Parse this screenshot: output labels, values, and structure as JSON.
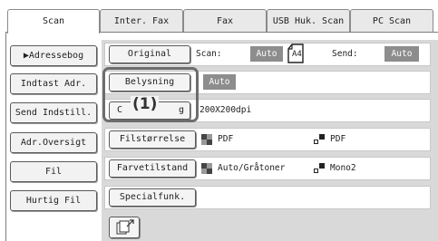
{
  "tabs": [
    "Scan",
    "Inter. Fax",
    "Fax",
    "USB Huk. Scan",
    "PC Scan"
  ],
  "left_menu": [
    "▶Adressebog",
    "Indtast Adr.",
    "Send Indstill.",
    "Adr.Oversigt",
    "Fil",
    "Hurtig Fil"
  ],
  "original": {
    "button": "Original",
    "scan_label": "Scan:",
    "scan_value": "Auto",
    "paper_size": "A4",
    "send_label": "Send:",
    "send_value": "Auto"
  },
  "exposure": {
    "button": "Belysning",
    "value": "Auto"
  },
  "resolution": {
    "button_partial": "C",
    "button_partial_end": "g",
    "value": "200X200dpi"
  },
  "callout": "(1)",
  "file_format": {
    "button": "Filstørrelse",
    "bw_format": "PDF",
    "color_format": "PDF"
  },
  "color_mode": {
    "button": "Farvetilstand",
    "color_value": "Auto/Gråtoner",
    "bw_value": "Mono2"
  },
  "special": {
    "button": "Specialfunk."
  },
  "colors": {
    "chip": "#8d8d8d",
    "panel": "#d9d9d9",
    "border": "#5a5a5a"
  },
  "icons": [
    "a4-page-icon",
    "bw-grid-icon",
    "color-square-icon",
    "edit-preview-icon"
  ]
}
